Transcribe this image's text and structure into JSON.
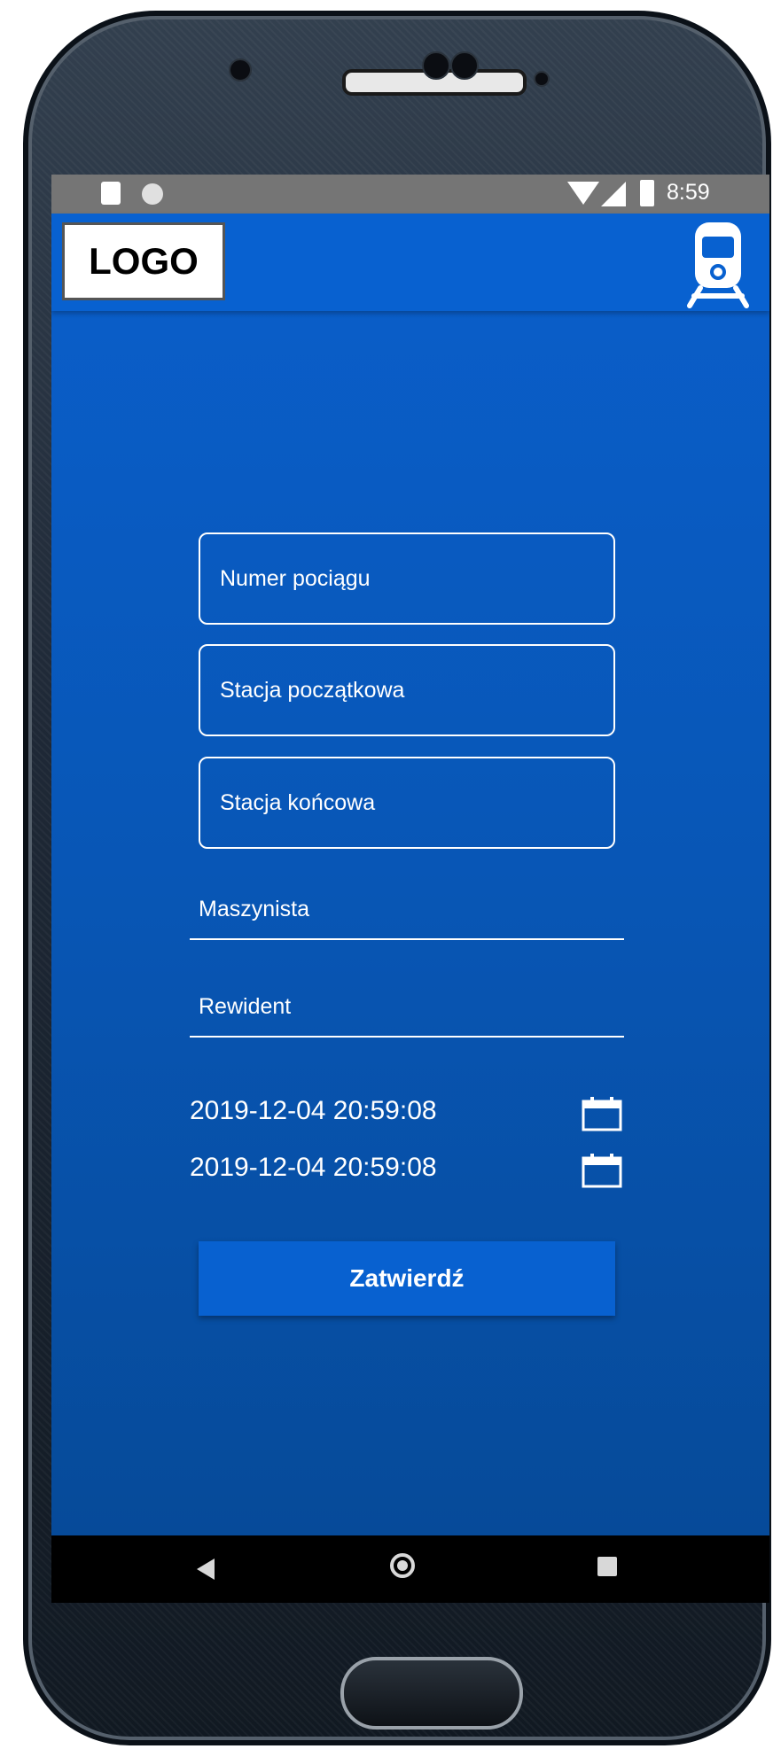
{
  "status_bar": {
    "time": "8:59"
  },
  "app_bar": {
    "logo_text": "LOGO",
    "train_icon": "train-icon"
  },
  "form": {
    "train_number_placeholder": "Numer pociągu",
    "start_station_placeholder": "Stacja początkowa",
    "end_station_placeholder": "Stacja końcowa",
    "driver_placeholder": "Maszynista",
    "inspector_placeholder": "Rewident",
    "datetime_start": "2019-12-04 20:59:08",
    "datetime_end": "2019-12-04 20:59:08",
    "calendar_icon": "calendar-icon",
    "submit_label": "Zatwierdź"
  },
  "nav_bar": {
    "back_icon": "back-icon",
    "home_icon": "home-icon",
    "recents_icon": "recents-icon"
  },
  "colors": {
    "primary": "#0861d0",
    "background_top": "#0a5fcc",
    "background_bottom": "#064996",
    "status_bar": "#757575",
    "text": "#ffffff"
  }
}
